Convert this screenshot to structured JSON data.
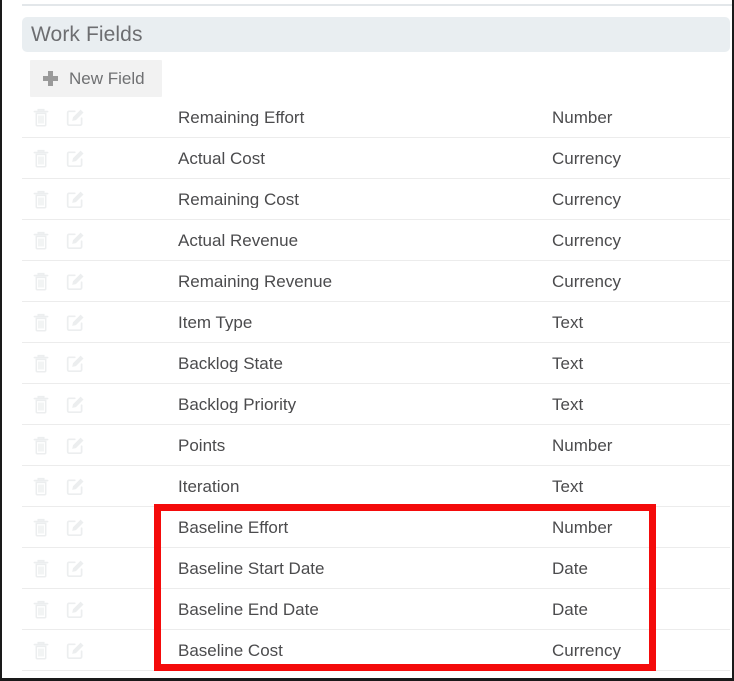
{
  "page": {
    "top_rule": true
  },
  "section": {
    "title": "Work Fields"
  },
  "toolbar": {
    "new_field_label": "New Field",
    "new_field_icon": "plus-icon"
  },
  "table": {
    "row_icons": {
      "delete": "trash-icon",
      "edit": "edit-pencil-icon"
    },
    "rows": [
      {
        "name": "Remaining Effort",
        "type": "Number",
        "highlighted": false
      },
      {
        "name": "Actual Cost",
        "type": "Currency",
        "highlighted": false
      },
      {
        "name": "Remaining Cost",
        "type": "Currency",
        "highlighted": false
      },
      {
        "name": "Actual Revenue",
        "type": "Currency",
        "highlighted": false
      },
      {
        "name": "Remaining Revenue",
        "type": "Currency",
        "highlighted": false
      },
      {
        "name": "Item Type",
        "type": "Text",
        "highlighted": false
      },
      {
        "name": "Backlog State",
        "type": "Text",
        "highlighted": false
      },
      {
        "name": "Backlog Priority",
        "type": "Text",
        "highlighted": false
      },
      {
        "name": "Points",
        "type": "Number",
        "highlighted": false
      },
      {
        "name": "Iteration",
        "type": "Text",
        "highlighted": false
      },
      {
        "name": "Baseline Effort",
        "type": "Number",
        "highlighted": true
      },
      {
        "name": "Baseline Start Date",
        "type": "Date",
        "highlighted": true
      },
      {
        "name": "Baseline End Date",
        "type": "Date",
        "highlighted": true
      },
      {
        "name": "Baseline Cost",
        "type": "Currency",
        "highlighted": true
      }
    ]
  },
  "annotation": {
    "type": "rectangle-highlight",
    "color": "#f40b0b"
  },
  "colors": {
    "header_bar": "#e9eef1",
    "button_bg": "#f2f2f2",
    "text": "#4b4b4d",
    "muted_text": "#6d6e71",
    "icon": "#eceeef",
    "row_divider": "#ececec",
    "highlight": "#f40b0b"
  }
}
